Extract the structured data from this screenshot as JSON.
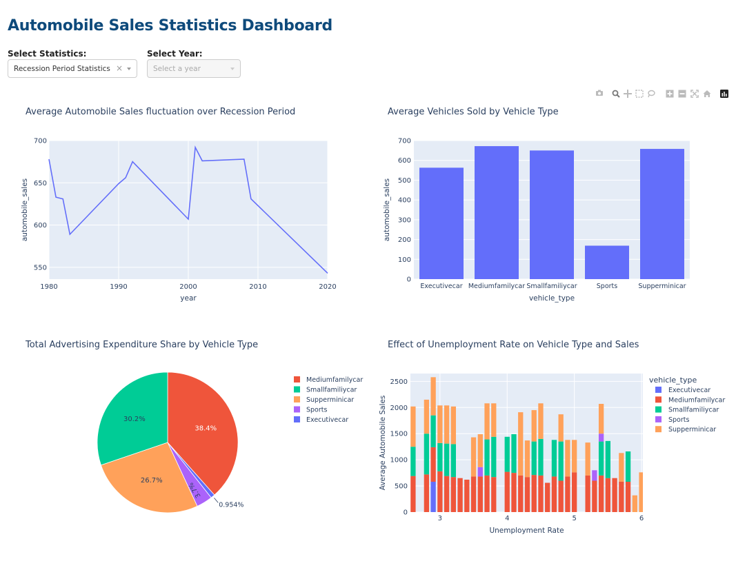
{
  "page": {
    "title": "Automobile Sales Statistics Dashboard",
    "select_statistics_label": "Select Statistics:",
    "select_statistics_value": "Recession Period Statistics",
    "select_year_label": "Select Year:",
    "select_year_placeholder": "Select a year"
  },
  "modebar_icons": [
    "camera-icon",
    "zoom-icon",
    "pan-icon",
    "box-select-icon",
    "lasso-icon",
    "zoom-in-icon",
    "zoom-out-icon",
    "autoscale-icon",
    "reset-axes-icon",
    "plotly-logo-icon"
  ],
  "colors": {
    "plot_bg": "#e5ecf6",
    "grid": "#ffffff",
    "text": "#2a3f5f",
    "title": "#0e4a7b",
    "series": {
      "Executivecar": "#636efa",
      "Mediumfamilycar": "#ef553b",
      "Smallfamiliycar": "#00cc96",
      "Sports": "#ab63fa",
      "Supperminicar": "#ffa15a"
    }
  },
  "chart_data": [
    {
      "type": "line",
      "title": "Average Automobile Sales fluctuation over Recession Period",
      "xlabel": "year",
      "ylabel": "automobile_sales",
      "xlim": [
        1980,
        2020
      ],
      "ylim": [
        536,
        700
      ],
      "xticks": [
        1980,
        1990,
        2000,
        2010,
        2020
      ],
      "yticks": [
        550,
        600,
        650,
        700
      ],
      "grid": true,
      "series": [
        {
          "x": [
            1980,
            1981,
            1982,
            1983,
            1990,
            1991,
            1992,
            2000,
            2001,
            2002,
            2008,
            2009,
            2020
          ],
          "y": [
            678,
            633,
            631,
            589,
            649,
            656,
            675,
            607,
            692,
            676,
            678,
            631,
            543
          ]
        }
      ]
    },
    {
      "type": "bar",
      "title": "Average Vehicles Sold by Vehicle Type",
      "xlabel": "vehicle_type",
      "ylabel": "automobile_sales",
      "ylim": [
        0,
        700
      ],
      "yticks": [
        0,
        100,
        200,
        300,
        400,
        500,
        600,
        700
      ],
      "categories": [
        "Executivecar",
        "Mediumfamilycar",
        "Smallfamiliycar",
        "Sports",
        "Supperminicar"
      ],
      "values": [
        563,
        672,
        650,
        169,
        658
      ],
      "grid": true
    },
    {
      "type": "pie",
      "title": "Total Advertising Expenditure Share by Vehicle Type",
      "legend_position": "right",
      "slices": [
        {
          "label": "Mediumfamilycar",
          "percent": 38.4,
          "text": "38.4%"
        },
        {
          "label": "Smallfamiliycar",
          "percent": 30.2,
          "text": "30.2%"
        },
        {
          "label": "Supperminicar",
          "percent": 26.7,
          "text": "26.7%"
        },
        {
          "label": "Sports",
          "percent": 3.7,
          "text": "3.7%"
        },
        {
          "label": "Executivecar",
          "percent": 0.954,
          "text": "0.954%"
        }
      ],
      "legend_order": [
        "Mediumfamilycar",
        "Smallfamiliycar",
        "Supperminicar",
        "Sports",
        "Executivecar"
      ],
      "draw_order": [
        "Mediumfamilycar",
        "Executivecar",
        "Sports",
        "Supperminicar",
        "Smallfamiliycar"
      ]
    },
    {
      "type": "bar",
      "stacked": true,
      "title": "Effect of Unemployment Rate on Vehicle Type and Sales",
      "xlabel": "Unemployment Rate",
      "ylabel": "Average Automobile Sales",
      "legend_title": "vehicle_type",
      "legend_position": "right",
      "xlim": [
        2.56,
        6.02
      ],
      "ylim": [
        0,
        2650
      ],
      "xticks": [
        3,
        4,
        5,
        6
      ],
      "yticks": [
        0,
        500,
        1000,
        1500,
        2000,
        2500
      ],
      "bar_width": 0.075,
      "series_names": [
        "Executivecar",
        "Mediumfamilycar",
        "Smallfamiliycar",
        "Sports",
        "Supperminicar"
      ],
      "stacks": [
        {
          "x": 2.6,
          "values": [
            0,
            690,
            560,
            0,
            770
          ]
        },
        {
          "x": 2.8,
          "values": [
            0,
            720,
            780,
            0,
            650
          ]
        },
        {
          "x": 2.9,
          "values": [
            580,
            660,
            610,
            0,
            730
          ]
        },
        {
          "x": 3.0,
          "values": [
            0,
            780,
            540,
            0,
            720
          ]
        },
        {
          "x": 3.1,
          "values": [
            0,
            690,
            620,
            0,
            730
          ]
        },
        {
          "x": 3.2,
          "values": [
            0,
            670,
            630,
            0,
            720
          ]
        },
        {
          "x": 3.3,
          "values": [
            0,
            650,
            0,
            0,
            0
          ]
        },
        {
          "x": 3.4,
          "values": [
            0,
            620,
            0,
            0,
            0
          ]
        },
        {
          "x": 3.5,
          "values": [
            0,
            680,
            0,
            0,
            750
          ]
        },
        {
          "x": 3.6,
          "values": [
            0,
            680,
            0,
            180,
            630
          ]
        },
        {
          "x": 3.7,
          "values": [
            0,
            700,
            690,
            0,
            690
          ]
        },
        {
          "x": 3.8,
          "values": [
            0,
            670,
            770,
            0,
            640
          ]
        },
        {
          "x": 4.0,
          "values": [
            0,
            770,
            670,
            0,
            0
          ]
        },
        {
          "x": 4.1,
          "values": [
            0,
            750,
            740,
            0,
            0
          ]
        },
        {
          "x": 4.2,
          "values": [
            0,
            700,
            0,
            0,
            1210
          ]
        },
        {
          "x": 4.3,
          "values": [
            0,
            670,
            0,
            0,
            700
          ]
        },
        {
          "x": 4.4,
          "values": [
            0,
            710,
            640,
            0,
            600
          ]
        },
        {
          "x": 4.5,
          "values": [
            0,
            700,
            700,
            0,
            680
          ]
        },
        {
          "x": 4.6,
          "values": [
            0,
            560,
            0,
            0,
            0
          ]
        },
        {
          "x": 4.7,
          "values": [
            0,
            680,
            700,
            0,
            0
          ]
        },
        {
          "x": 4.8,
          "values": [
            0,
            600,
            750,
            0,
            520
          ]
        },
        {
          "x": 4.9,
          "values": [
            0,
            680,
            0,
            0,
            700
          ]
        },
        {
          "x": 5.0,
          "values": [
            0,
            760,
            0,
            0,
            620
          ]
        },
        {
          "x": 5.2,
          "values": [
            0,
            700,
            0,
            0,
            630
          ]
        },
        {
          "x": 5.3,
          "values": [
            0,
            600,
            0,
            200,
            0
          ]
        },
        {
          "x": 5.4,
          "values": [
            0,
            700,
            650,
            150,
            570
          ]
        },
        {
          "x": 5.5,
          "values": [
            0,
            650,
            710,
            0,
            0
          ]
        },
        {
          "x": 5.6,
          "values": [
            0,
            650,
            0,
            0,
            0
          ]
        },
        {
          "x": 5.7,
          "values": [
            0,
            580,
            0,
            0,
            550
          ]
        },
        {
          "x": 5.8,
          "values": [
            0,
            580,
            580,
            0,
            0
          ]
        },
        {
          "x": 5.9,
          "values": [
            0,
            0,
            0,
            0,
            320
          ]
        },
        {
          "x": 6.0,
          "values": [
            0,
            0,
            0,
            0,
            760
          ]
        }
      ]
    }
  ]
}
